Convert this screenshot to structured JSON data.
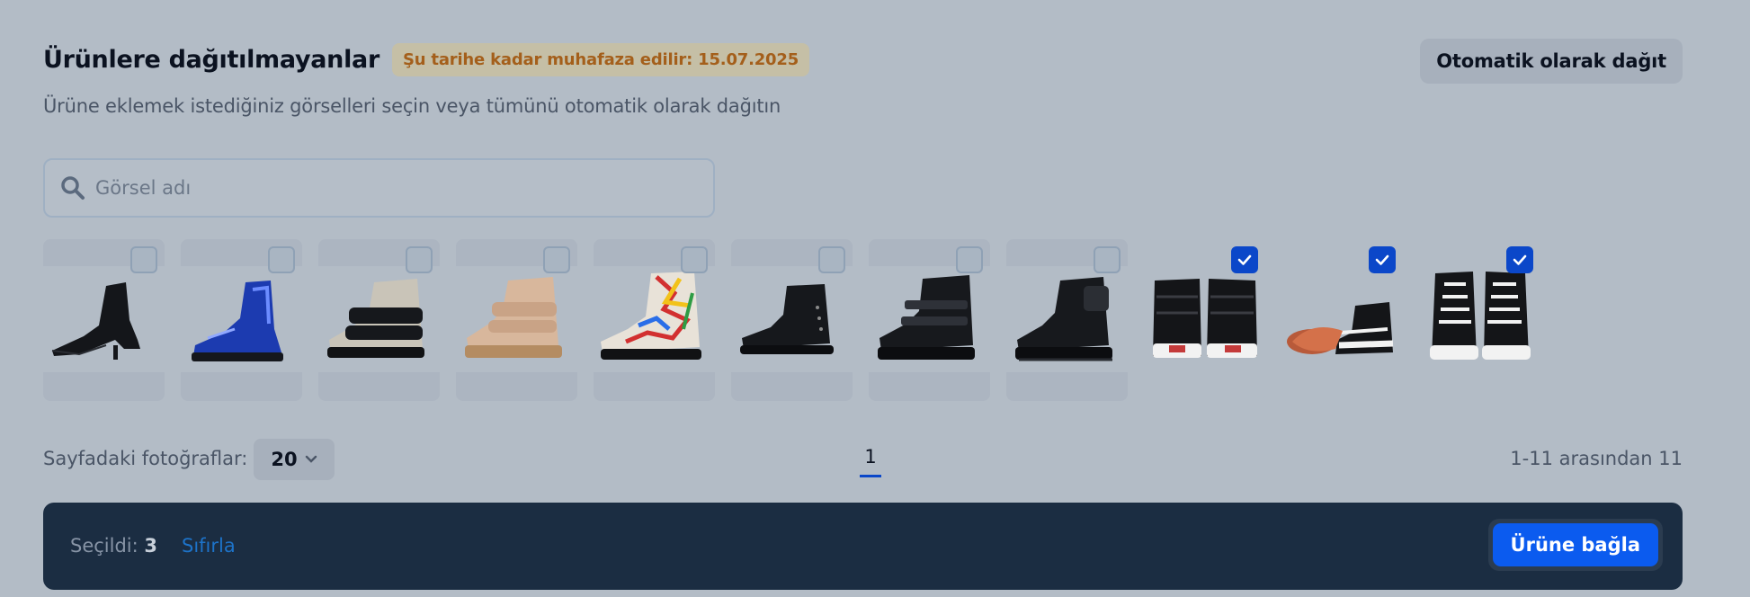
{
  "header": {
    "title": "Ürünlere dağıtılmayanlar",
    "badge": "Şu tarihe kadar muhafaza edilir: 15.07.2025",
    "auto_button": "Otomatik olarak dağıt",
    "subtitle": "Ürüne eklemek istediğiniz görselleri seçin veya tümünü otomatik olarak dağıtın"
  },
  "search": {
    "placeholder": "Görsel adı",
    "icon": "search-icon"
  },
  "images": [
    {
      "checked": false,
      "kind": "black-heel-boot"
    },
    {
      "checked": false,
      "kind": "blue-metallic-boot"
    },
    {
      "checked": false,
      "kind": "silver-velcro-boot"
    },
    {
      "checked": false,
      "kind": "gold-velcro-boot"
    },
    {
      "checked": false,
      "kind": "graffiti-boot"
    },
    {
      "checked": false,
      "kind": "black-ankle-boot"
    },
    {
      "checked": false,
      "kind": "black-strap-boot"
    },
    {
      "checked": false,
      "kind": "black-pocket-boot"
    },
    {
      "checked": true,
      "kind": "sneaker-back"
    },
    {
      "checked": true,
      "kind": "sneaker-side"
    },
    {
      "checked": true,
      "kind": "sneaker-front"
    }
  ],
  "pagination": {
    "per_page_label": "Sayfadaki fotoğraflar:",
    "per_page_value": "20",
    "current_page": "1",
    "count_text": "1-11 arasından 11"
  },
  "footer": {
    "selected_label": "Seçildi:",
    "selected_count": "3",
    "reset_label": "Sıfırla",
    "attach_button": "Ürüne bağla"
  },
  "colors": {
    "accent": "#0b5bef",
    "checkbox_checked": "#0b47c9",
    "badge_text": "#a45f1b"
  }
}
